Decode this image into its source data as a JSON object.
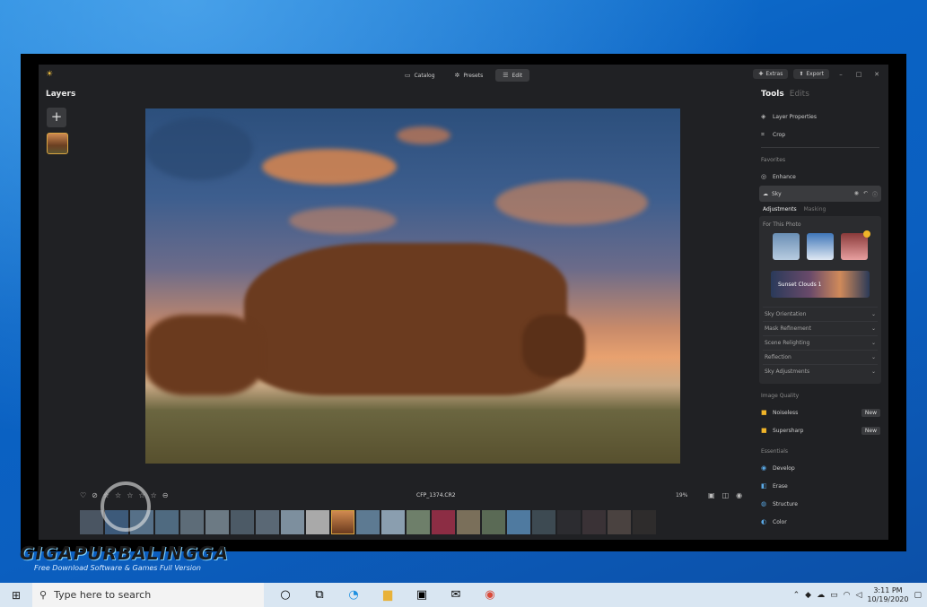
{
  "app": {
    "titlebar": {
      "tabs": [
        {
          "label": "Catalog",
          "icon": "folder-icon"
        },
        {
          "label": "Presets",
          "icon": "presets-icon"
        },
        {
          "label": "Edit",
          "icon": "sliders-icon"
        }
      ],
      "extras_label": "Extras",
      "export_label": "Export"
    },
    "layers": {
      "title": "Layers",
      "add_label": "+"
    },
    "filmstrip": {
      "filename": "CFP_1374.CR2",
      "zoom": "19%"
    },
    "tools": {
      "title": "Tools",
      "edits": "Edits",
      "layer_properties": "Layer Properties",
      "crop": "Crop",
      "favorites": "Favorites",
      "enhance": "Enhance",
      "sky": "Sky",
      "subtabs": [
        "Adjustments",
        "Masking"
      ],
      "for_this_photo": "For This Photo",
      "sky_preset": "Sunset Clouds 1",
      "accordion": [
        "Sky Orientation",
        "Mask Refinement",
        "Scene Relighting",
        "Reflection",
        "Sky Adjustments"
      ],
      "image_quality": "Image Quality",
      "noiseless": "Noiseless",
      "supersharp": "Supersharp",
      "new_badge": "New",
      "essentials": "Essentials",
      "develop": "Develop",
      "erase": "Erase",
      "structure": "Structure",
      "color": "Color"
    }
  },
  "watermark": {
    "name": "GIGAPURBALINGGA",
    "tagline": "Free Download Software & Games Full Version"
  },
  "taskbar": {
    "search_placeholder": "Type here to search",
    "time": "3:11 PM",
    "date": "10/19/2020"
  },
  "colors": {
    "accent": "#d9a441",
    "panel_bg": "#202124"
  }
}
